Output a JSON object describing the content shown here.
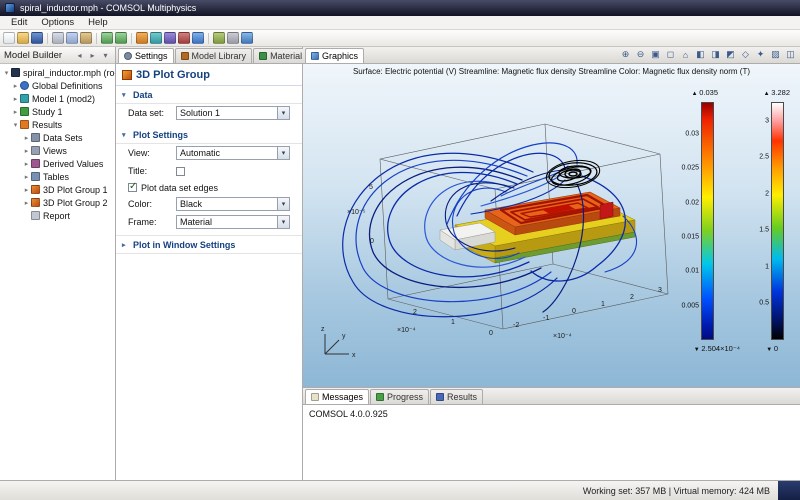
{
  "window": {
    "title": "spiral_inductor.mph - COMSOL Multiphysics"
  },
  "menu": {
    "items": [
      "Edit",
      "Options",
      "Help"
    ]
  },
  "toolbar": {
    "icons": [
      "new-icon",
      "open-icon",
      "save-icon",
      "print-icon",
      "cut-icon",
      "copy-icon",
      "paste-icon",
      "undo-icon",
      "redo-icon",
      "geometry-icon",
      "mesh-icon",
      "compute-icon",
      "study-icon",
      "plot-icon",
      "zoom-extents-icon",
      "image-icon",
      "help-icon"
    ]
  },
  "model_builder": {
    "title": "Model Builder",
    "tree": [
      {
        "label": "spiral_inductor.mph (root)"
      },
      {
        "label": "Global Definitions"
      },
      {
        "label": "Model 1 (mod2)"
      },
      {
        "label": "Study 1"
      },
      {
        "label": "Results"
      },
      {
        "label": "Data Sets"
      },
      {
        "label": "Views"
      },
      {
        "label": "Derived Values"
      },
      {
        "label": "Tables"
      },
      {
        "label": "3D Plot Group 1"
      },
      {
        "label": "3D Plot Group 2"
      },
      {
        "label": "Report"
      }
    ]
  },
  "settings": {
    "tabs": [
      "Settings",
      "Model Library",
      "Material Browser"
    ],
    "header": "3D Plot Group",
    "data_section": {
      "title": "Data",
      "data_set_label": "Data set:",
      "data_set_value": "Solution 1"
    },
    "plot_settings": {
      "title": "Plot Settings",
      "view_label": "View:",
      "view_value": "Automatic",
      "title_label": "Title:",
      "edges_label": "Plot data set edges",
      "color_label": "Color:",
      "color_value": "Black",
      "frame_label": "Frame:",
      "frame_value": "Material"
    },
    "window_section": {
      "title": "Plot in Window Settings"
    }
  },
  "graphics": {
    "tab": "Graphics",
    "plot_title": "Surface: Electric potential (V) Streamline: Magnetic flux density  Streamline Color: Magnetic flux density norm (T)",
    "colorbar_surface": {
      "max": "0.035",
      "ticks": [
        "0.03",
        "0.025",
        "0.02",
        "0.015",
        "0.01",
        "0.005"
      ],
      "min": "2.504×10⁻⁴"
    },
    "colorbar_streamline": {
      "max": "3.282",
      "ticks": [
        "3",
        "2.5",
        "2",
        "1.5",
        "1",
        "0.5"
      ],
      "min": "0"
    },
    "axes": {
      "x_ticks": [
        "-2",
        "-1",
        "0",
        "1",
        "2",
        "3"
      ],
      "x_scale": "×10⁻⁴",
      "y_ticks": [
        "2",
        "1",
        "0"
      ],
      "y_scale": "×10⁻⁴",
      "z_ticks": [
        "5",
        "0"
      ],
      "z_scale": "×10⁻⁵",
      "triad": {
        "x": "x",
        "y": "y",
        "z": "z"
      }
    }
  },
  "bottom_panel": {
    "tabs": [
      "Messages",
      "Progress",
      "Results"
    ],
    "message": "COMSOL 4.0.0.925"
  },
  "status_bar": {
    "memory": "Working set: 357 MB | Virtual memory: 424 MB"
  }
}
